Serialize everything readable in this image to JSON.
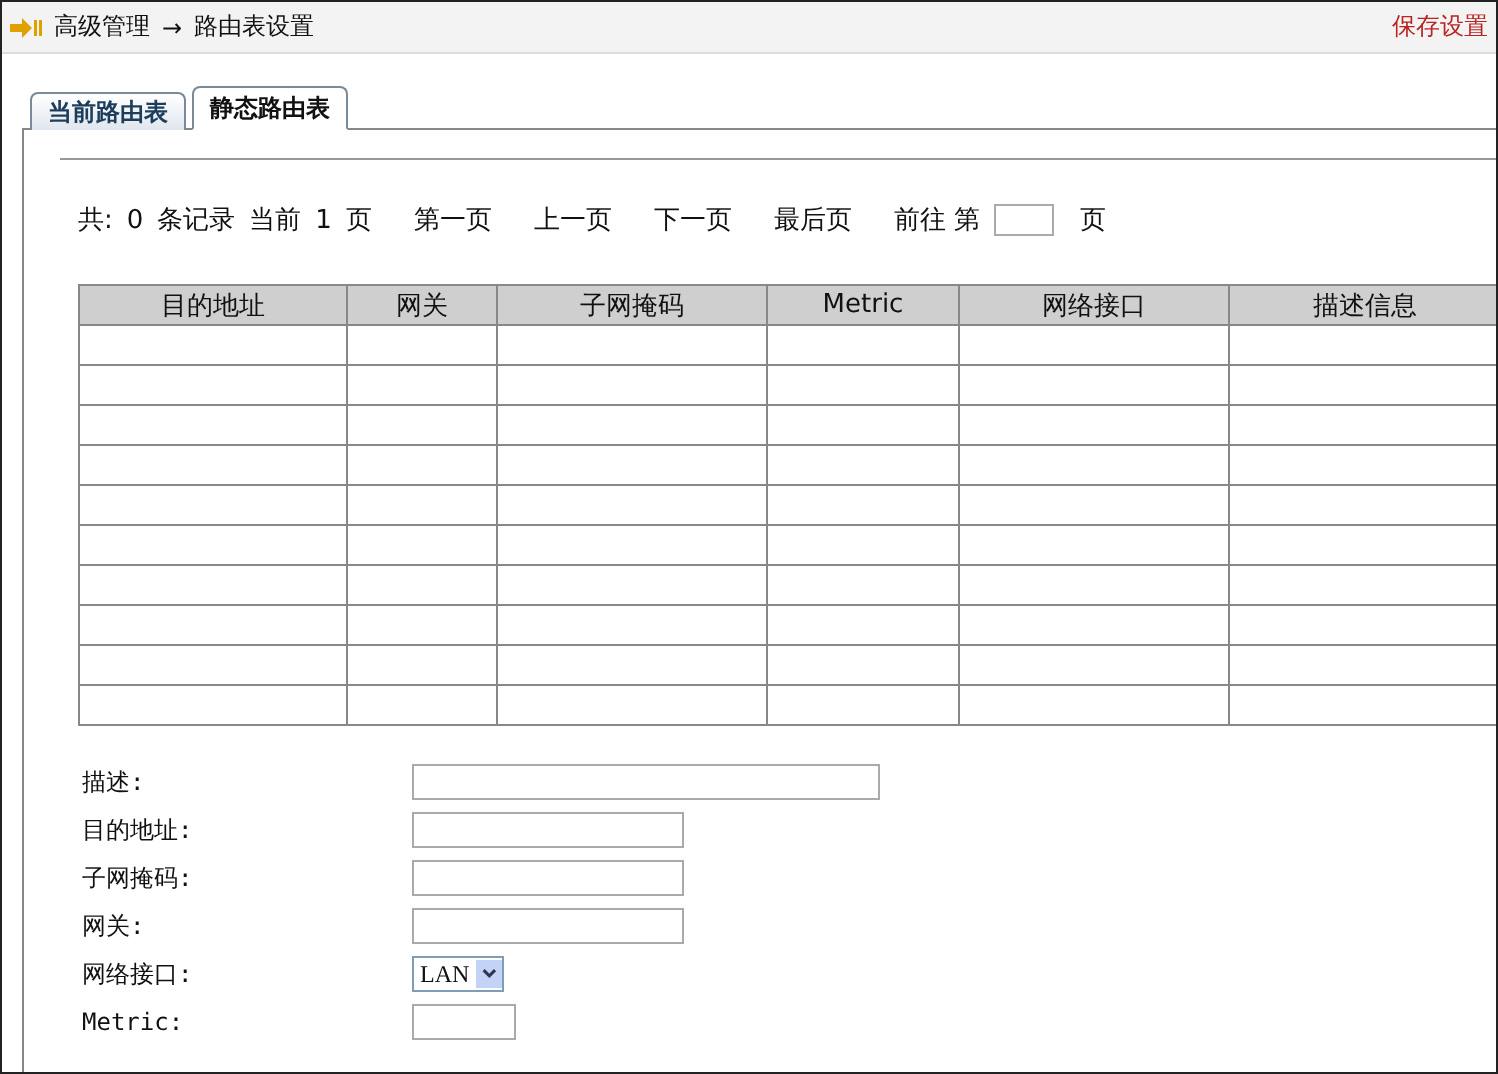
{
  "header": {
    "breadcrumb": [
      "高级管理",
      "路由表设置"
    ],
    "arrow": "→",
    "save": "保存设置"
  },
  "tabs": [
    {
      "label": "当前路由表",
      "selected": false
    },
    {
      "label": "静态路由表",
      "selected": true
    }
  ],
  "pager": {
    "total_prefix": "共:",
    "total": "0",
    "total_suffix": "条记录",
    "current_prefix": "当前",
    "current": "1",
    "current_suffix": "页",
    "links": [
      "第一页",
      "上一页",
      "下一页",
      "最后页"
    ],
    "goto_prefix": "前往 第",
    "goto_suffix": "页"
  },
  "table": {
    "columns": [
      "目的地址",
      "网关",
      "子网掩码",
      "Metric",
      "网络接口",
      "描述信息"
    ]
  },
  "form": [
    {
      "label": "描述:",
      "kind": "long"
    },
    {
      "label": "目的地址:",
      "kind": "text"
    },
    {
      "label": "子网掩码:",
      "kind": "text"
    },
    {
      "label": "网关:",
      "kind": "text"
    },
    {
      "label": "网络接口:",
      "kind": "select",
      "value": "LAN"
    },
    {
      "label": "Metric:",
      "kind": "short"
    }
  ]
}
